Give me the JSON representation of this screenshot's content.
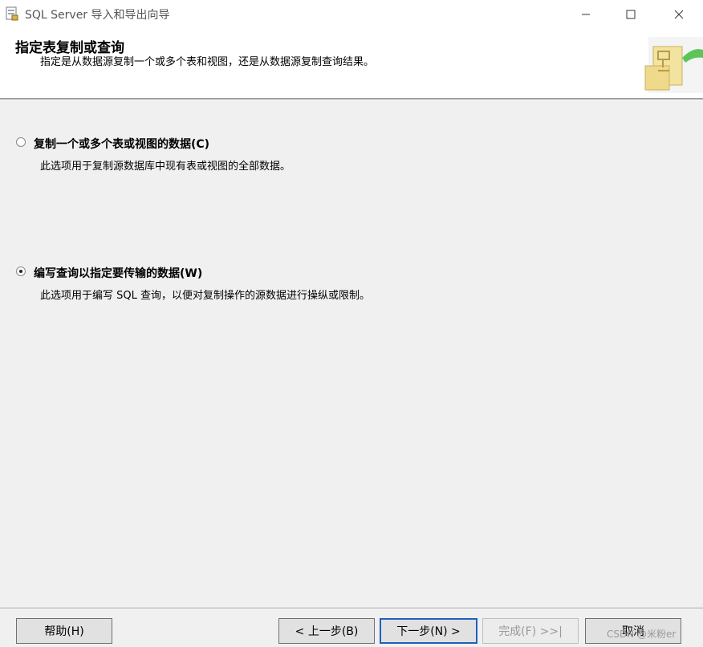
{
  "window": {
    "title": "SQL Server 导入和导出向导"
  },
  "header": {
    "title": "指定表复制或查询",
    "subtitle": "指定是从数据源复制一个或多个表和视图，还是从数据源复制查询结果。"
  },
  "options": [
    {
      "label": "复制一个或多个表或视图的数据(C)",
      "description": "此选项用于复制源数据库中现有表或视图的全部数据。",
      "selected": false
    },
    {
      "label": "编写查询以指定要传输的数据(W)",
      "description": "此选项用于编写 SQL 查询，以便对复制操作的源数据进行操纵或限制。",
      "selected": true
    }
  ],
  "buttons": {
    "help": "帮助(H)",
    "back": "< 上一步(B)",
    "next": "下一步(N) >",
    "finish": "完成(F) >>|",
    "cancel": "取消"
  },
  "watermark": "CSDN @米粉er",
  "colors": {
    "header_bg": "#ffffff",
    "body_bg": "#f0f0f0",
    "default_button_border": "#1f5fbf"
  }
}
